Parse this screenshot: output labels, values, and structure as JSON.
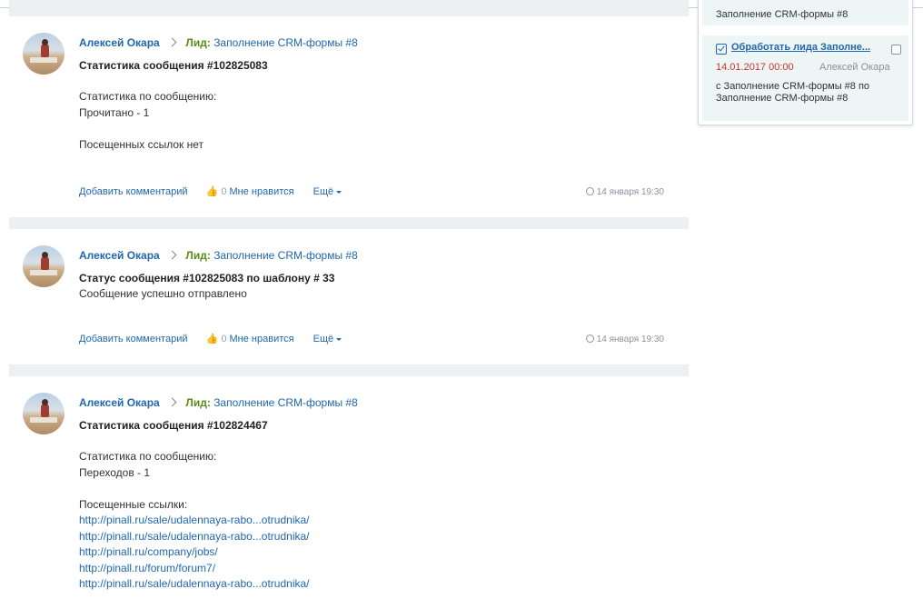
{
  "posts": [
    {
      "author": "Алексей Окара",
      "lead_label": "Лид:",
      "lead_name": "Заполнение CRM-формы #8",
      "title": "Статистика сообщения #102825083",
      "lines": [
        "Статистика по сообщению:",
        "Прочитано - 1",
        "",
        "Посещенных ссылок нет"
      ],
      "add_comment": "Добавить комментарий",
      "likes": "0",
      "like_label": "Мне нравится",
      "more": "Ещё",
      "time": "14 января 19:30"
    },
    {
      "author": "Алексей Окара",
      "lead_label": "Лид:",
      "lead_name": "Заполнение CRM-формы #8",
      "title": "Статус сообщения #102825083 по шаблону # 33",
      "lines": [
        "Сообщение успешно отправлено"
      ],
      "add_comment": "Добавить комментарий",
      "likes": "0",
      "like_label": "Мне нравится",
      "more": "Ещё",
      "time": "14 января 19:30"
    },
    {
      "author": "Алексей Окара",
      "lead_label": "Лид:",
      "lead_name": "Заполнение CRM-формы #8",
      "title": "Статистика сообщения #102824467",
      "lines": [
        "Статистика по сообщению:",
        "Переходов - 1",
        "",
        "Посещенные ссылки:"
      ],
      "links": [
        "http://pinall.ru/sale/udalennaya-rabo...otrudnika/",
        "http://pinall.ru/sale/udalennaya-rabo...otrudnika/",
        "http://pinall.ru/company/jobs/",
        "http://pinall.ru/forum/forum7/",
        "http://pinall.ru/sale/udalennaya-rabo...otrudnika/"
      ]
    }
  ],
  "tasks": {
    "previous_desc": "Заполнение CRM-формы #8",
    "current": {
      "title": "Обработать лида Заполне...",
      "date": "14.01.2017 00:00",
      "owner": "Алексей Окара",
      "desc_line1": "с Заполнение CRM-формы #8 по",
      "desc_line2": "Заполнение CRM-формы #8"
    }
  },
  "colors": {
    "link": "#2067b0",
    "lead_label": "#5c8c17",
    "date_overdue": "#d0312d",
    "feed_gap": "#edf0f2"
  }
}
